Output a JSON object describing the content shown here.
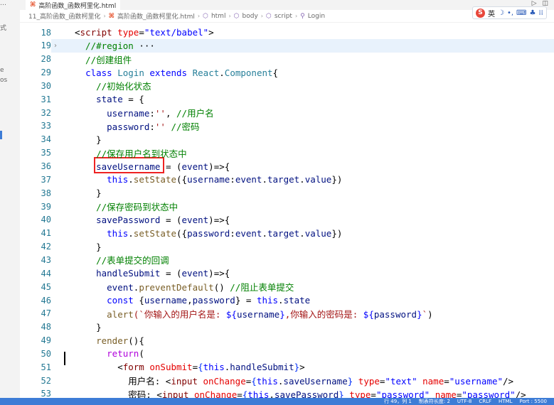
{
  "tab": {
    "filename": "高阶函数_函数柯里化.html"
  },
  "breadcrumb": {
    "folder": "11_高阶函数_函数柯里化",
    "file": "高阶函数_函数柯里化.html",
    "html": "html",
    "body": "body",
    "script": "script",
    "symbol": "Login"
  },
  "ime": {
    "mode": "英",
    "moon": "☽",
    "punct": "•,",
    "keyboard": "⌨",
    "skin": "♣",
    "grid": "⁞⁞"
  },
  "left_frags": [
    "…",
    "式",
    "e",
    "os"
  ],
  "lines": [
    {
      "n": "18",
      "t": [
        [
          "<",
          "pun"
        ],
        [
          "script",
          "tagc"
        ],
        [
          " type",
          "attr"
        ],
        [
          "=",
          "pun"
        ],
        [
          "\"text/babel\"",
          "kw"
        ],
        [
          ">",
          "pun"
        ]
      ]
    },
    {
      "n": "19",
      "fold": "›",
      "t": [
        [
          "  //#region",
          "cm"
        ],
        [
          " ···",
          "plain"
        ]
      ],
      "hl": true
    },
    {
      "n": "28",
      "t": [
        [
          "  //创建组件",
          "cm"
        ]
      ]
    },
    {
      "n": "29",
      "t": [
        [
          "  ",
          "plain"
        ],
        [
          "class",
          "kw"
        ],
        [
          " ",
          "plain"
        ],
        [
          "Login",
          "cls"
        ],
        [
          " ",
          "plain"
        ],
        [
          "extends",
          "kw"
        ],
        [
          " ",
          "plain"
        ],
        [
          "React",
          "cls"
        ],
        [
          ".",
          "pun"
        ],
        [
          "Component",
          "cls"
        ],
        [
          "{",
          "pun"
        ]
      ]
    },
    {
      "n": "30",
      "t": [
        [
          "    //初始化状态",
          "cm"
        ]
      ]
    },
    {
      "n": "31",
      "t": [
        [
          "    state",
          "var"
        ],
        [
          " = {",
          "pun"
        ]
      ]
    },
    {
      "n": "32",
      "t": [
        [
          "      username",
          "var"
        ],
        [
          ":",
          "pun"
        ],
        [
          "''",
          "str"
        ],
        [
          ", ",
          "pun"
        ],
        [
          "//用户名",
          "cm"
        ]
      ]
    },
    {
      "n": "33",
      "t": [
        [
          "      password",
          "var"
        ],
        [
          ":",
          "pun"
        ],
        [
          "''",
          "str"
        ],
        [
          " ",
          "pun"
        ],
        [
          "//密码",
          "cm"
        ]
      ]
    },
    {
      "n": "34",
      "t": [
        [
          "    }",
          "pun"
        ]
      ]
    },
    {
      "n": "35",
      "t": [
        [
          "    //保存用户名到状态中",
          "cm"
        ]
      ]
    },
    {
      "n": "36",
      "t": [
        [
          "    saveUsername",
          "var"
        ],
        [
          " = (",
          "pun"
        ],
        [
          "event",
          "var"
        ],
        [
          ")=>{",
          "pun"
        ]
      ]
    },
    {
      "n": "37",
      "t": [
        [
          "      ",
          "plain"
        ],
        [
          "this",
          "kw"
        ],
        [
          ".",
          "pun"
        ],
        [
          "setState",
          "fn"
        ],
        [
          "({",
          "pun"
        ],
        [
          "username",
          "var"
        ],
        [
          ":",
          "pun"
        ],
        [
          "event",
          "var"
        ],
        [
          ".",
          "pun"
        ],
        [
          "target",
          "var"
        ],
        [
          ".",
          "pun"
        ],
        [
          "value",
          "var"
        ],
        [
          "})",
          "pun"
        ]
      ]
    },
    {
      "n": "38",
      "t": [
        [
          "    }",
          "pun"
        ]
      ]
    },
    {
      "n": "39",
      "t": [
        [
          "    //保存密码到状态中",
          "cm"
        ]
      ]
    },
    {
      "n": "40",
      "t": [
        [
          "    savePassword",
          "var"
        ],
        [
          " = (",
          "pun"
        ],
        [
          "event",
          "var"
        ],
        [
          ")=>{",
          "pun"
        ]
      ]
    },
    {
      "n": "41",
      "t": [
        [
          "      ",
          "plain"
        ],
        [
          "this",
          "kw"
        ],
        [
          ".",
          "pun"
        ],
        [
          "setState",
          "fn"
        ],
        [
          "({",
          "pun"
        ],
        [
          "password",
          "var"
        ],
        [
          ":",
          "pun"
        ],
        [
          "event",
          "var"
        ],
        [
          ".",
          "pun"
        ],
        [
          "target",
          "var"
        ],
        [
          ".",
          "pun"
        ],
        [
          "value",
          "var"
        ],
        [
          "})",
          "pun"
        ]
      ]
    },
    {
      "n": "42",
      "t": [
        [
          "    }",
          "pun"
        ]
      ]
    },
    {
      "n": "43",
      "t": [
        [
          "    //表单提交的回调",
          "cm"
        ]
      ]
    },
    {
      "n": "44",
      "t": [
        [
          "    handleSubmit",
          "var"
        ],
        [
          " = (",
          "pun"
        ],
        [
          "event",
          "var"
        ],
        [
          ")=>{",
          "pun"
        ]
      ]
    },
    {
      "n": "45",
      "t": [
        [
          "      event",
          "var"
        ],
        [
          ".",
          "pun"
        ],
        [
          "preventDefault",
          "fn"
        ],
        [
          "() ",
          "pun"
        ],
        [
          "//阻止表单提交",
          "cm"
        ]
      ]
    },
    {
      "n": "46",
      "t": [
        [
          "      ",
          "plain"
        ],
        [
          "const",
          "kw"
        ],
        [
          " {",
          "pun"
        ],
        [
          "username",
          "var"
        ],
        [
          ",",
          "pun"
        ],
        [
          "password",
          "var"
        ],
        [
          "} = ",
          "pun"
        ],
        [
          "this",
          "kw"
        ],
        [
          ".",
          "pun"
        ],
        [
          "state",
          "var"
        ]
      ]
    },
    {
      "n": "47",
      "t": [
        [
          "      ",
          "plain"
        ],
        [
          "alert",
          "fn"
        ],
        [
          "(`你输入的用户名是: ",
          "str"
        ],
        [
          "${",
          "kw"
        ],
        [
          "username",
          "var"
        ],
        [
          "}",
          "kw"
        ],
        [
          ",你输入的密码是: ",
          "str"
        ],
        [
          "${",
          "kw"
        ],
        [
          "password",
          "var"
        ],
        [
          "}",
          "kw"
        ],
        [
          "`",
          "str"
        ],
        [
          ")",
          "pun"
        ]
      ]
    },
    {
      "n": "48",
      "t": [
        [
          "    }",
          "pun"
        ]
      ]
    },
    {
      "n": "49",
      "t": [
        [
          "    ",
          "plain"
        ],
        [
          "render",
          "fn"
        ],
        [
          "(){",
          "pun"
        ]
      ]
    },
    {
      "n": "50",
      "t": [
        [
          "      ",
          "plain"
        ],
        [
          "return",
          "kw2"
        ],
        [
          "(",
          "pun"
        ]
      ]
    },
    {
      "n": "51",
      "t": [
        [
          "        <",
          "pun"
        ],
        [
          "form",
          "tagc"
        ],
        [
          " onSubmit",
          "attr"
        ],
        [
          "=",
          "pun"
        ],
        [
          "{",
          "brace"
        ],
        [
          "this",
          "kw"
        ],
        [
          ".",
          "pun"
        ],
        [
          "handleSubmit",
          "var"
        ],
        [
          "}",
          "brace"
        ],
        [
          ">",
          "pun"
        ]
      ]
    },
    {
      "n": "52",
      "t": [
        [
          "          用户名: <",
          "plain"
        ],
        [
          "input",
          "tagc"
        ],
        [
          " onChange",
          "attr"
        ],
        [
          "=",
          "pun"
        ],
        [
          "{",
          "brace"
        ],
        [
          "this",
          "kw"
        ],
        [
          ".",
          "pun"
        ],
        [
          "saveUsername",
          "var"
        ],
        [
          "}",
          "brace"
        ],
        [
          " type",
          "attr"
        ],
        [
          "=",
          "pun"
        ],
        [
          "\"text\"",
          "kw"
        ],
        [
          " name",
          "attr"
        ],
        [
          "=",
          "pun"
        ],
        [
          "\"username\"",
          "kw"
        ],
        [
          "/>",
          "pun"
        ]
      ]
    },
    {
      "n": "53",
      "t": [
        [
          "          密码: <",
          "plain"
        ],
        [
          "input",
          "tagc"
        ],
        [
          " onChange",
          "attr"
        ],
        [
          "=",
          "pun"
        ],
        [
          "{",
          "brace"
        ],
        [
          "this",
          "kw"
        ],
        [
          ".",
          "pun"
        ],
        [
          "savePassword",
          "var"
        ],
        [
          "}",
          "brace"
        ],
        [
          " type",
          "attr"
        ],
        [
          "=",
          "pun"
        ],
        [
          "\"password\"",
          "kw"
        ],
        [
          " name",
          "attr"
        ],
        [
          "=",
          "pun"
        ],
        [
          "\"password\"",
          "kw"
        ],
        [
          "/>",
          "pun"
        ]
      ]
    }
  ],
  "status": [
    "行 49，列 1",
    "制表符长度: 2",
    "UTF-8",
    "CRLF",
    "HTML",
    "Port : 5500"
  ]
}
